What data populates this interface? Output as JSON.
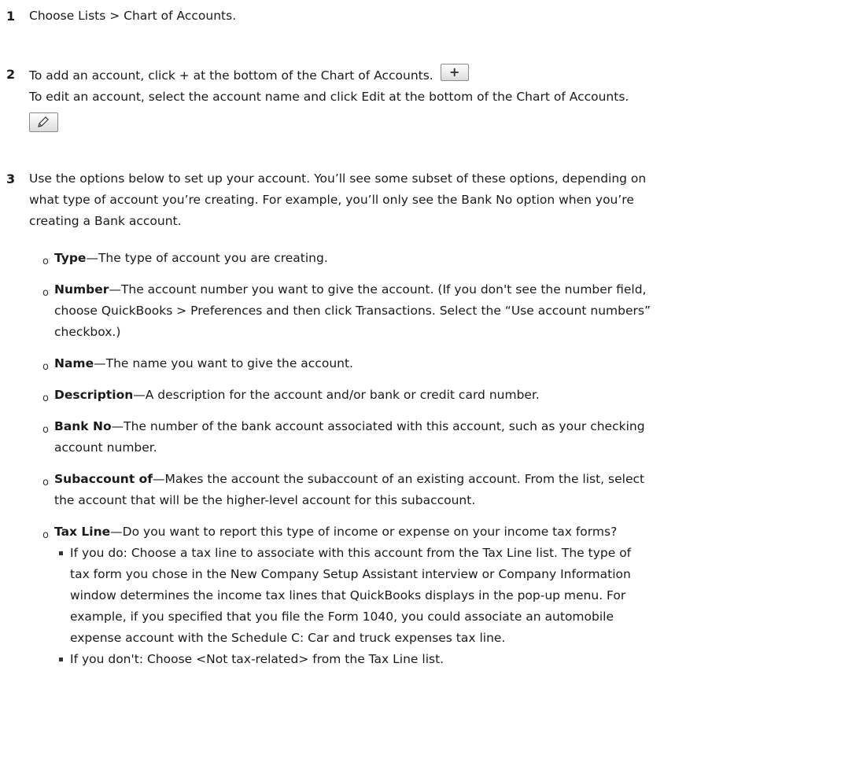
{
  "steps": [
    {
      "number": "1",
      "lines": [
        "Choose Lists > Chart of Accounts."
      ]
    },
    {
      "number": "2",
      "add_text": "To add an account, click + at the bottom of the Chart of Accounts.",
      "add_button_icon": "plus-icon",
      "add_button_glyph": "+",
      "edit_text": "To edit an account, select the account name and click Edit at the bottom of the Chart of Accounts.",
      "edit_button_icon": "pencil-icon"
    },
    {
      "number": "3",
      "lines": [
        "Use the options below to set up your account. You’ll see some subset of these options, depending on",
        "what type of account you’re creating. For example, you’ll only see the Bank No option when you’re",
        "creating a Bank account."
      ]
    }
  ],
  "options": [
    {
      "term": "Type",
      "lines": [
        "—The type of account you are creating."
      ]
    },
    {
      "term": "Number",
      "lines": [
        "—The account number you want to give the account. (If you don't see the number field,",
        "choose QuickBooks > Preferences and then click Transactions. Select the “Use account numbers”",
        "checkbox.)"
      ]
    },
    {
      "term": "Name",
      "lines": [
        "—The name you want to give the account."
      ]
    },
    {
      "term": "Description",
      "lines": [
        "—A description for the account and/or bank or credit card number."
      ]
    },
    {
      "term": "Bank No",
      "lines": [
        "—The number of the bank account associated with this account, such as your checking",
        "account number."
      ]
    },
    {
      "term": "Subaccount of",
      "lines": [
        "—Makes the account the subaccount of an existing account. From the list, select",
        "the account that will be the higher-level account for this subaccount."
      ]
    },
    {
      "term": "Tax Line",
      "lines": [
        "—Do you want to report this type of income or expense on your income tax forms?"
      ],
      "subitems": [
        {
          "lines": [
            "If you do: Choose a tax line to associate with this account from the Tax Line list. The type of",
            "tax form you chose in the New Company Setup Assistant interview or Company Information",
            "window determines the income tax lines that QuickBooks displays in the pop-up menu. For",
            "example, if you specified that you file the Form 1040, you could associate an automobile",
            "expense account with the Schedule C: Car and truck expenses tax line."
          ]
        },
        {
          "lines": [
            "If you don't: Choose <Not tax-related> from the Tax Line list."
          ]
        }
      ]
    }
  ]
}
